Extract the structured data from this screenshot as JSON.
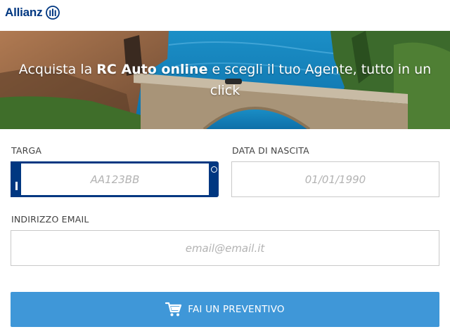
{
  "brand": {
    "name": "Allianz",
    "color": "#003781"
  },
  "hero": {
    "text_before": "Acquista la ",
    "text_bold": "RC Auto online",
    "text_after": " e scegli il tuo Agente, tutto in un click"
  },
  "form": {
    "plate": {
      "label": "TARGA",
      "placeholder": "AA123BB",
      "value": ""
    },
    "birthdate": {
      "label": "DATA DI NASCITA",
      "placeholder": "01/01/1990",
      "value": ""
    },
    "email": {
      "label": "INDIRIZZO EMAIL",
      "placeholder": "email@email.it",
      "value": ""
    },
    "submit": {
      "label": "FAI UN PREVENTIVO",
      "icon": "cart-icon",
      "color": "#3f97d8"
    }
  }
}
